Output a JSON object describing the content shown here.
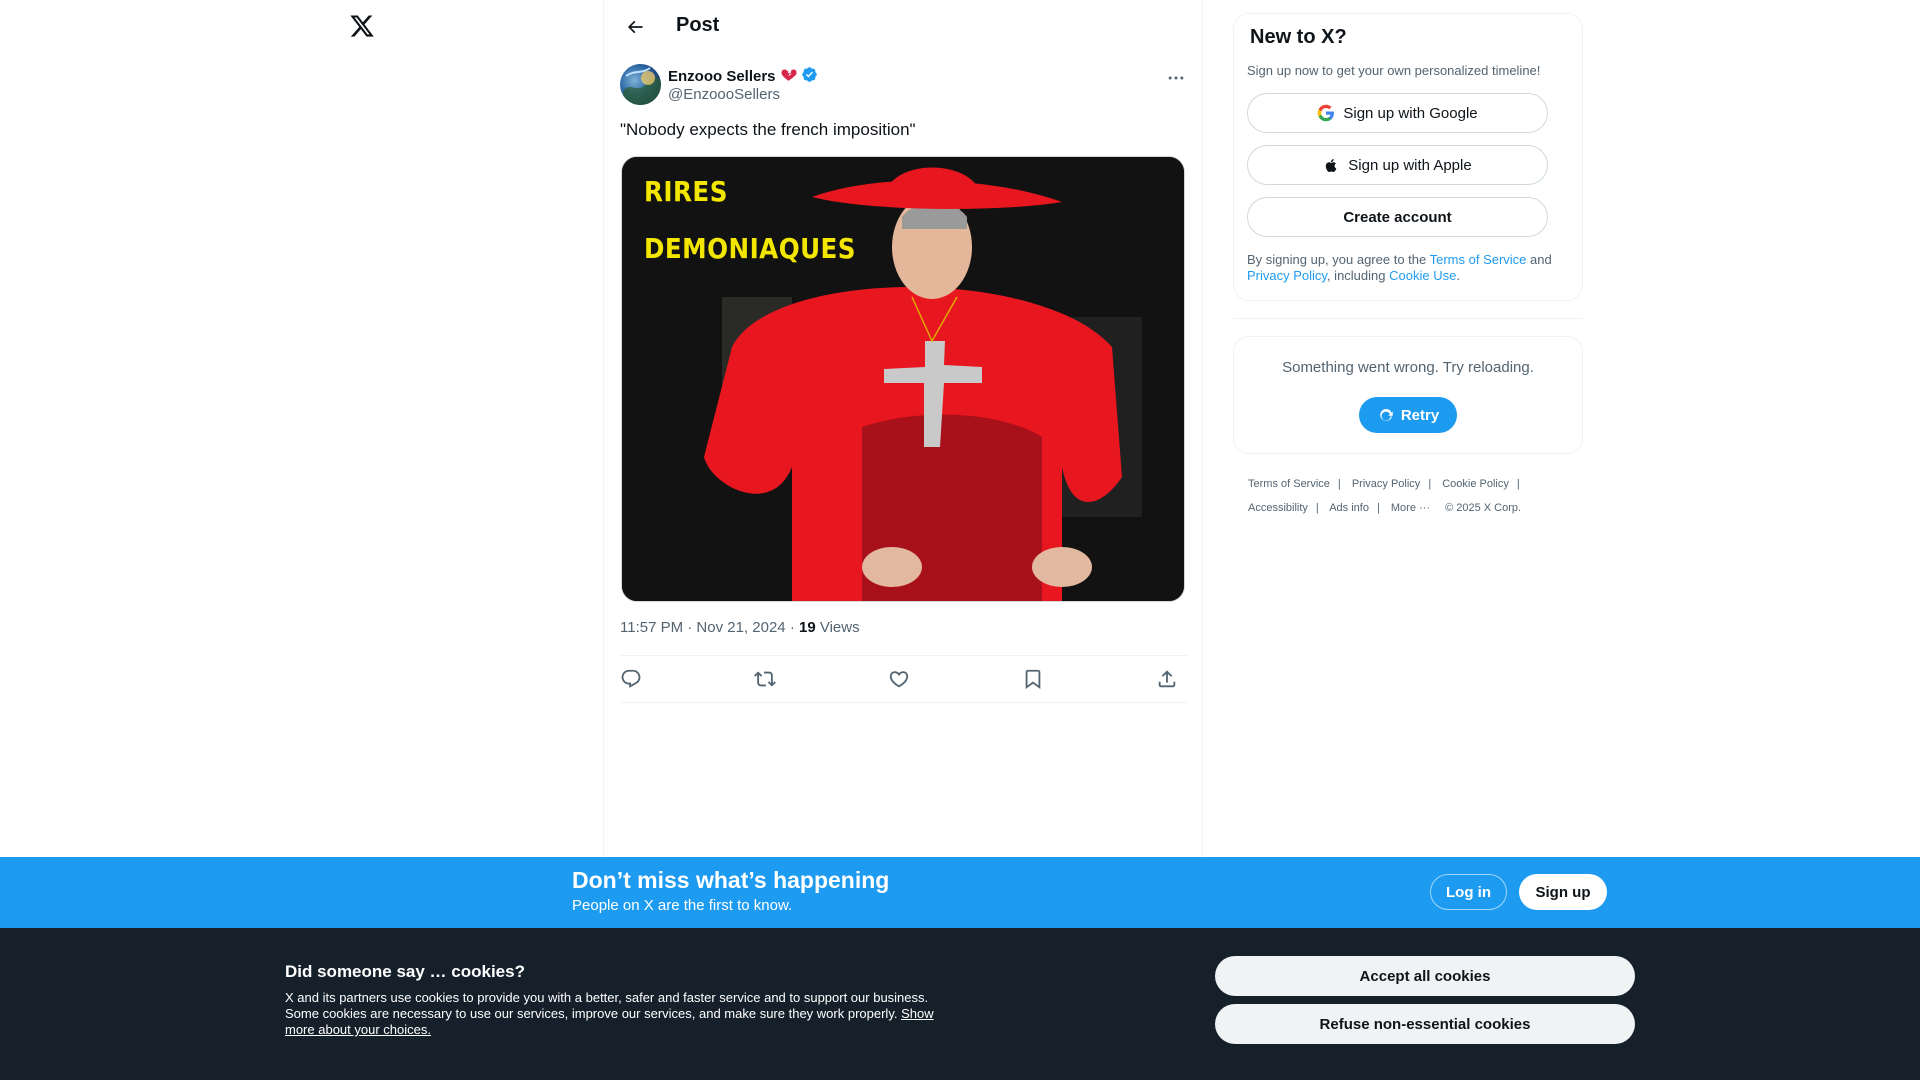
{
  "nav": {
    "logo_icon": "x-logo-icon"
  },
  "header": {
    "title": "Post",
    "back_icon": "arrow-left-icon"
  },
  "tweet": {
    "author_name": "Enzooo Sellers",
    "author_handle": "@EnzoooSellers",
    "text": "\"Nobody expects the french imposition\"",
    "media_text_line1": "RIRES",
    "media_text_line2": "DEMONIAQUES",
    "time": "11:57 PM · Nov 21, 2024",
    "views_count": "19",
    "views_label": "Views",
    "actions": [
      "reply-icon",
      "retweet-icon",
      "like-icon",
      "bookmark-icon",
      "share-icon"
    ]
  },
  "signup": {
    "title": "New to X?",
    "subtitle": "Sign up now to get your own personalized timeline!",
    "google": "Sign up with Google",
    "apple": "Sign up with Apple",
    "create": "Create account",
    "legal_prefix": "By signing up, you agree to the ",
    "tos": "Terms of Service",
    "and": " and ",
    "privacy": "Privacy Policy",
    "including": ", including ",
    "cookie_use": "Cookie Use",
    "period": "."
  },
  "error": {
    "text": "Something went wrong. Try reloading.",
    "retry": "Retry"
  },
  "footer": {
    "tos": "Terms of Service",
    "privacy": "Privacy Policy",
    "cookie": "Cookie Policy",
    "accessibility": "Accessibility",
    "ads": "Ads info",
    "more": "More ···",
    "copyright": "© 2025 X Corp."
  },
  "banner": {
    "title": "Don’t miss what’s happening",
    "subtitle": "People on X are the first to know.",
    "login": "Log in",
    "signup": "Sign up"
  },
  "cookies": {
    "title": "Did someone say … cookies?",
    "body": "X and its partners use cookies to provide you with a better, safer and faster service and to support our business. Some cookies are necessary to use our services, improve our services, and make sure they work properly. ",
    "link": "Show more about your choices.",
    "accept": "Accept all cookies",
    "refuse": "Refuse non-essential cookies"
  },
  "colors": {
    "accent": "#1d9bf0",
    "cookie_bg": "#15202b",
    "text": "#0f1419",
    "muted": "#536471"
  }
}
